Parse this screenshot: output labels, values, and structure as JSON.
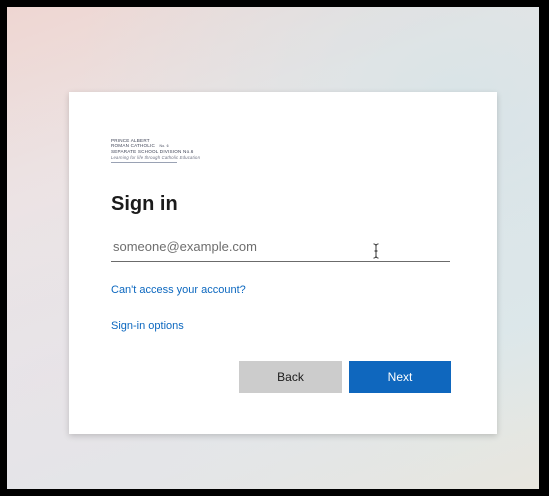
{
  "logo": {
    "line1": "PRINCE ALBERT",
    "line2": "ROMAN CATHOLIC",
    "line2_small": "No. 6",
    "line3": "SEPARATE SCHOOL DIVISION No.6",
    "motto": "Learning for life through Catholic Education"
  },
  "title": "Sign in",
  "email": {
    "placeholder": "someone@example.com",
    "value": ""
  },
  "links": {
    "cant_access": "Can't access your account?",
    "signin_options": "Sign-in options"
  },
  "buttons": {
    "back": "Back",
    "next": "Next"
  },
  "colors": {
    "accent": "#0f67be",
    "link": "#0b67bf",
    "back_button": "#cccccc"
  },
  "icons": {
    "cursor": "text-cursor-icon"
  }
}
